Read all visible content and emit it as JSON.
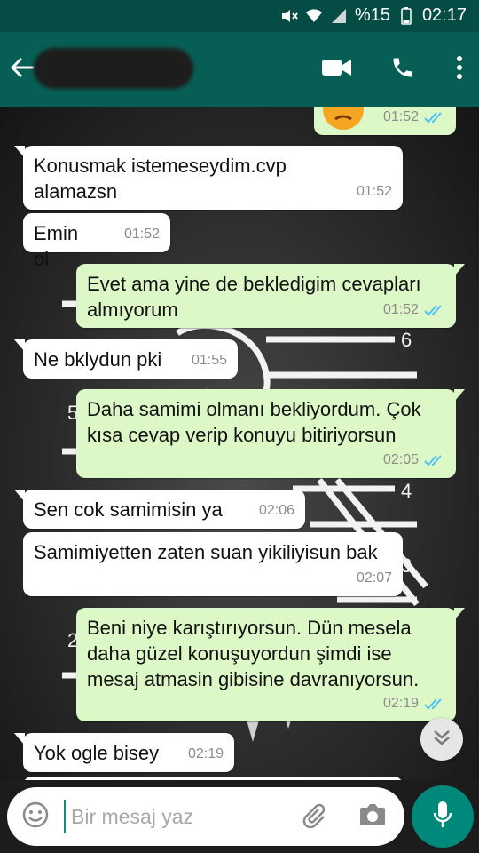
{
  "status_bar": {
    "battery_percent": "%15",
    "time": "02:17",
    "icons": [
      "mute-icon",
      "wifi-icon",
      "signal-icon",
      "battery-icon"
    ]
  },
  "header": {
    "contact_name": "",
    "icons": [
      "back-arrow-icon",
      "video-call-icon",
      "phone-icon",
      "more-vert-icon"
    ]
  },
  "colors": {
    "header": "#075e54",
    "status_bar": "#054d44",
    "outgoing_bubble": "#dcf8c6",
    "incoming_bubble": "#ffffff",
    "read_ticks": "#4fc3f7",
    "mic_button": "#00897b"
  },
  "messages": [
    {
      "dir": "out",
      "text": "",
      "time": "01:52",
      "read": true
    },
    {
      "dir": "in",
      "text": "Konusmak istemeseydim.cvp alamazsn",
      "time": "01:52"
    },
    {
      "dir": "in",
      "text": "Emin ol",
      "time": "01:52"
    },
    {
      "dir": "out",
      "text": "Evet ama yine de bekledigim cevapları almıyorum",
      "time": "01:52",
      "read": true
    },
    {
      "dir": "in",
      "text": "Ne bklydun pki",
      "time": "01:55"
    },
    {
      "dir": "out",
      "text": "Daha samimi olmanı bekliyordum. Çok kısa cevap verip konuyu bitiriyorsun",
      "time": "02:05",
      "read": true
    },
    {
      "dir": "in",
      "text": "Sen cok samimisin ya",
      "time": "02:06"
    },
    {
      "dir": "in",
      "text": "Samimiyetten zaten suan yikiliyisun bak",
      "time": "02:07"
    },
    {
      "dir": "out",
      "text": "Beni niye karıştırıyorsun. Dün mesela daha güzel konuşuyordun şimdi ise mesaj atmasin gibisine davranıyorsun.",
      "time": "02:19",
      "read": true
    },
    {
      "dir": "in",
      "text": "Yok ogle bisey",
      "time": "02:19"
    }
  ],
  "wallpaper_numbers": [
    "6",
    "5",
    "4",
    "3",
    "2"
  ],
  "composer": {
    "placeholder": "Bir mesaj yaz",
    "value": ""
  }
}
